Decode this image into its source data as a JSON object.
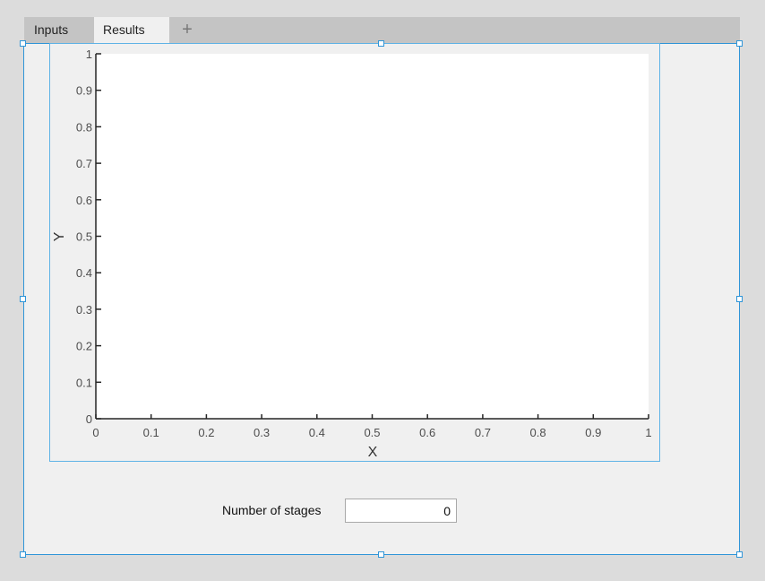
{
  "tabs": [
    {
      "label": "Inputs"
    },
    {
      "label": "Results"
    }
  ],
  "add_tab_label": "+",
  "colors": {
    "selection_blue": "#2f95d8",
    "panel_bg": "#f0f0f0",
    "tabbar_bg": "#c4c4c4",
    "plot_bg": "#ffffff",
    "axis_color": "#262626"
  },
  "chart_data": {
    "type": "line",
    "title": "",
    "xlabel": "X",
    "ylabel": "Y",
    "xlim": [
      0,
      1
    ],
    "ylim": [
      0,
      1
    ],
    "xticks": [
      "0",
      "0.1",
      "0.2",
      "0.3",
      "0.4",
      "0.5",
      "0.6",
      "0.7",
      "0.8",
      "0.9",
      "1"
    ],
    "yticks": [
      "0",
      "0.1",
      "0.2",
      "0.3",
      "0.4",
      "0.5",
      "0.6",
      "0.7",
      "0.8",
      "0.9",
      "1"
    ],
    "grid": false,
    "series": []
  },
  "stages": {
    "label": "Number of stages",
    "value": "0"
  }
}
